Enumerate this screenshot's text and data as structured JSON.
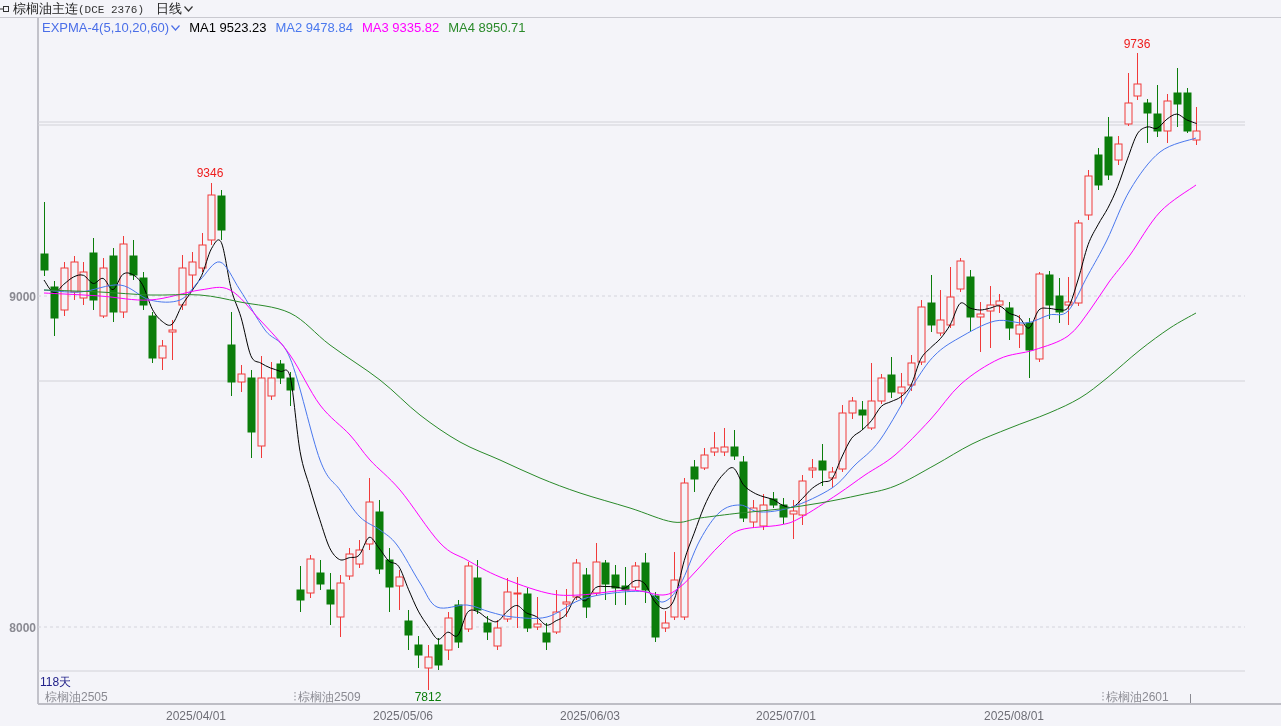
{
  "header": {
    "title": "棕榈油主连",
    "code": "(DCE 2376)",
    "period": "日线"
  },
  "indicator": {
    "label": "EXPMA-4(5,10,20,60)",
    "lines": [
      {
        "text": "MA1 9523.23",
        "color": "#000000"
      },
      {
        "text": "MA2 9478.84",
        "color": "#4a78ee"
      },
      {
        "text": "MA3 9335.82",
        "color": "#ff00ff"
      },
      {
        "text": "MA4 8950.71",
        "color": "#2a8a2a"
      }
    ]
  },
  "chart": {
    "y_labels": [
      "9000",
      "8000"
    ],
    "x_labels": [
      "2025/04/01",
      "2025/05/06",
      "2025/06/03",
      "2025/07/01",
      "2025/08/01"
    ],
    "high_labels": [
      "9346",
      "9736"
    ],
    "low_label": "7812",
    "day_count": "118天",
    "contract_labels": [
      "棕榈油2505",
      "棕榈油2509",
      "棕榈油2601"
    ]
  }
}
